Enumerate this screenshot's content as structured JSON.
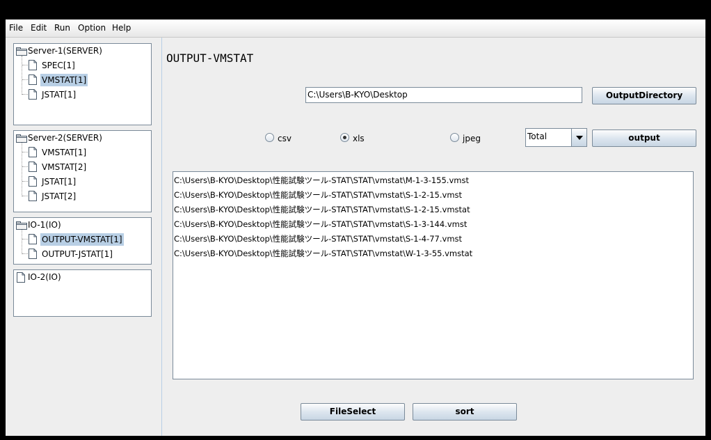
{
  "menu": [
    {
      "label": "File"
    },
    {
      "label": "Edit"
    },
    {
      "label": "Run"
    },
    {
      "label": "Option"
    },
    {
      "label": "Help"
    }
  ],
  "tree": {
    "groups": [
      {
        "label": "Server-1(SERVER)",
        "children": [
          "SPEC[1]",
          "VMSTAT[1]",
          "JSTAT[1]"
        ]
      },
      {
        "label": "Server-2(SERVER)",
        "children": [
          "VMSTAT[1]",
          "VMSTAT[2]",
          "JSTAT[1]",
          "JSTAT[2]"
        ]
      },
      {
        "label": "IO-1(IO)",
        "children": [
          "OUTPUT-VMSTAT[1]",
          "OUTPUT-JSTAT[1]"
        ]
      },
      {
        "label": "IO-2(IO)",
        "children": []
      }
    ]
  },
  "main": {
    "title": "OUTPUT-VMSTAT",
    "directory_value": "C:\\Users\\B-KYO\\Desktop",
    "output_directory_label": "OutputDirectory",
    "format_options": [
      {
        "label": "csv",
        "checked": false
      },
      {
        "label": "xls",
        "checked": true
      },
      {
        "label": "jpeg",
        "checked": false
      }
    ],
    "combo_value": "Total",
    "output_label": "output",
    "files": [
      "C:\\Users\\B-KYO\\Desktop\\性能試験ツール-STAT\\STAT\\vmstat\\M-1-3-155.vmst",
      "C:\\Users\\B-KYO\\Desktop\\性能試験ツール-STAT\\STAT\\vmstat\\S-1-2-15.vmst",
      "C:\\Users\\B-KYO\\Desktop\\性能試験ツール-STAT\\STAT\\vmstat\\S-1-2-15.vmstat",
      "C:\\Users\\B-KYO\\Desktop\\性能試験ツール-STAT\\STAT\\vmstat\\S-1-3-144.vmst",
      "C:\\Users\\B-KYO\\Desktop\\性能試験ツール-STAT\\STAT\\vmstat\\S-1-4-77.vmst",
      "C:\\Users\\B-KYO\\Desktop\\性能試験ツール-STAT\\STAT\\vmstat\\W-1-3-55.vmstat"
    ],
    "file_select_label": "FileSelect",
    "sort_label": "sort"
  },
  "colors": {
    "selection": "#b8cfe5",
    "background": "#eeeeee",
    "border": "#7a8a99"
  }
}
